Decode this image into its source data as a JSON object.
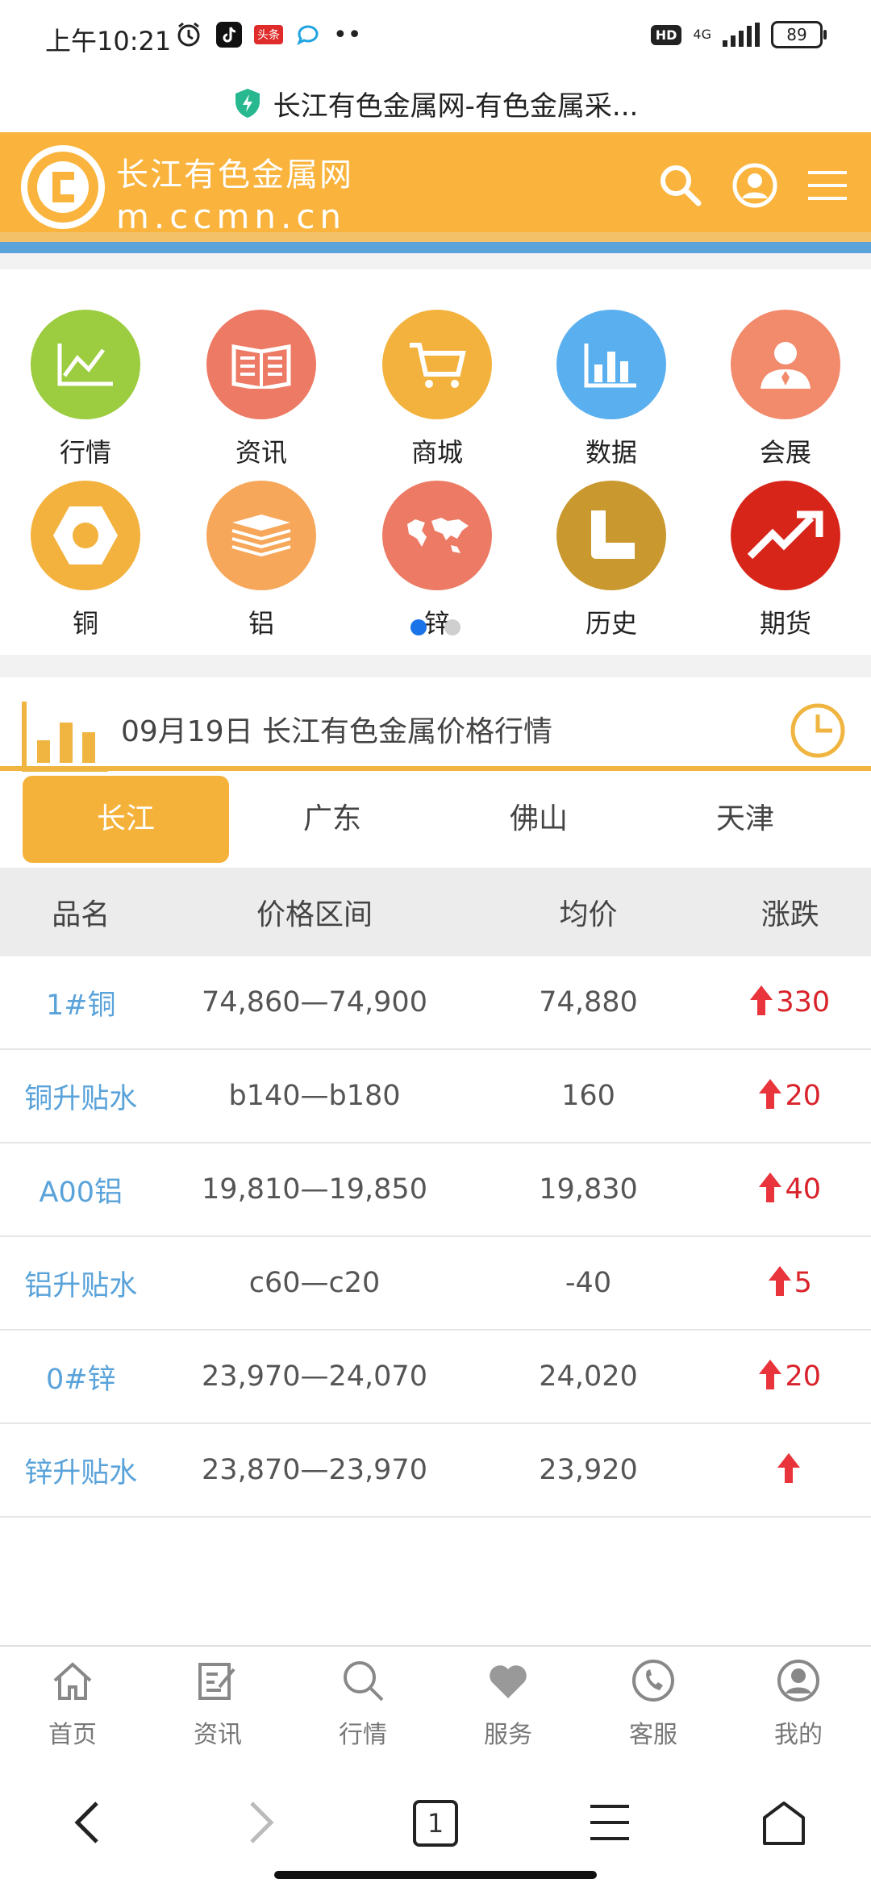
{
  "status_bar": {
    "time": "上午10:21",
    "toutiao": "头条",
    "hd": "HD",
    "network": "4G",
    "battery": "89"
  },
  "browser": {
    "page_title": "长江有色金属网-有色金属采..."
  },
  "header": {
    "site_name": "长江有色金属网",
    "domain": "m.ccmn.cn",
    "brand_color": "#fab43d"
  },
  "icon_nav": {
    "items": [
      {
        "label": "行情",
        "color": "#9ccc3f",
        "icon": "line-chart-icon"
      },
      {
        "label": "资讯",
        "color": "#ed7a64",
        "icon": "newspaper-icon"
      },
      {
        "label": "商城",
        "color": "#f3b23d",
        "icon": "cart-icon"
      },
      {
        "label": "数据",
        "color": "#5aafef",
        "icon": "bar-chart-icon"
      },
      {
        "label": "会展",
        "color": "#f28a6c",
        "icon": "person-icon"
      },
      {
        "label": "铜",
        "color": "#f3b23d",
        "icon": "hexagon-nut-icon"
      },
      {
        "label": "铝",
        "color": "#f6a75a",
        "icon": "stack-icon"
      },
      {
        "label": "锌",
        "color": "#ed7a64",
        "icon": "world-map-icon"
      },
      {
        "label": "历史",
        "color": "#c9992f",
        "icon": "l-shape-icon"
      },
      {
        "label": "期货",
        "color": "#d8251a",
        "icon": "trend-up-icon"
      }
    ],
    "page_count": 2,
    "active_page": 1
  },
  "price_section": {
    "title": "09月19日  长江有色金属价格行情",
    "tabs": [
      "长江",
      "广东",
      "佛山",
      "天津"
    ],
    "active_tab": 0,
    "columns": [
      "品名",
      "价格区间",
      "均价",
      "涨跌"
    ],
    "rows": [
      {
        "name": "1#铜",
        "range": "74,860—74,900",
        "avg": "74,880",
        "change": "330"
      },
      {
        "name": "铜升贴水",
        "range": "b140—b180",
        "avg": "160",
        "change": "20"
      },
      {
        "name": "A00铝",
        "range": "19,810—19,850",
        "avg": "19,830",
        "change": "40"
      },
      {
        "name": "铝升贴水",
        "range": "c60—c20",
        "avg": "-40",
        "change": "5"
      },
      {
        "name": "0#锌",
        "range": "23,970—24,070",
        "avg": "24,020",
        "change": "20"
      },
      {
        "name": "锌升贴水",
        "range": "23,870—23,970",
        "avg": "23,920",
        "change": ""
      }
    ]
  },
  "bottom_nav": [
    "首页",
    "资讯",
    "行情",
    "服务",
    "客服",
    "我的"
  ],
  "browser_bar": {
    "tab_count": "1"
  }
}
